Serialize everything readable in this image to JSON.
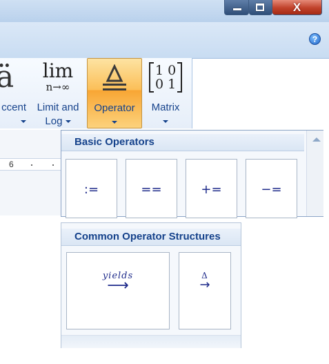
{
  "window": {
    "minimize_icon": "minimize-icon",
    "restore_icon": "restore-icon",
    "close_label": "X"
  },
  "help": {
    "label": "?"
  },
  "ribbon": {
    "accent": {
      "glyph": "ä",
      "label": "ccent",
      "icon": "accent-icon"
    },
    "limit": {
      "glyph_top": "lim",
      "glyph_bottom": "n→∞",
      "label1": "Limit and",
      "label2": "Log",
      "icon": "limit-icon"
    },
    "operator": {
      "glyph": "≜",
      "label": "Operator",
      "icon": "operator-icon"
    },
    "matrix": {
      "row1": "10",
      "row2": "01",
      "label": "Matrix",
      "icon": "matrix-icon"
    }
  },
  "ruler": {
    "number": "6"
  },
  "basic_operators": {
    "heading": "Basic Operators",
    "items": [
      ":=",
      "==",
      "+=",
      "−="
    ]
  },
  "common_structures": {
    "heading": "Common Operator Structures",
    "items": [
      {
        "top": "yields",
        "arrow": "⟶"
      },
      {
        "top": "Δ",
        "arrow": "→"
      }
    ]
  },
  "colors": {
    "ribbon_text": "#15428b",
    "operator_highlight": "#fbbf58",
    "close_button": "#c0412a",
    "operator_glyph": "#1d2a8a"
  }
}
